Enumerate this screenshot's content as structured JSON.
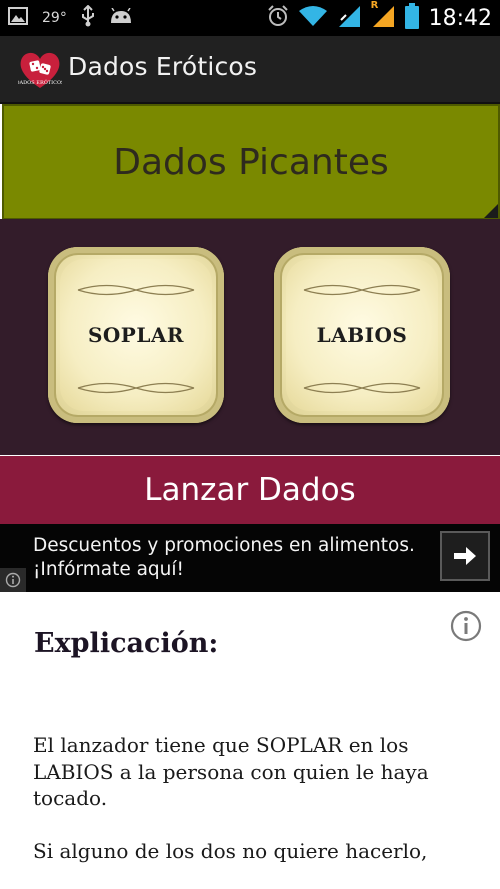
{
  "status_bar": {
    "temperature": "29°",
    "time": "18:42",
    "roaming_indicator": "R",
    "icons_left": [
      "gallery-icon",
      "usb-icon",
      "android-debug-icon"
    ],
    "icons_right": [
      "alarm-icon",
      "wifi-icon",
      "signal-icon",
      "signal-roaming-icon",
      "battery-icon"
    ]
  },
  "action_bar": {
    "title": "Dados Eróticos",
    "logo_caption": "DADOS ERÓTICOS"
  },
  "category": {
    "label": "Dados Picantes"
  },
  "dice": [
    {
      "word": "SOPLAR"
    },
    {
      "word": "LABIOS"
    }
  ],
  "roll_button": {
    "label": "Lanzar Dados"
  },
  "ad": {
    "line1": "Descuentos y promociones en alimentos.",
    "line2": "¡Infórmate aquí!"
  },
  "explanation": {
    "title": "Explicación:",
    "paragraphs": [
      "El lanzador tiene que SOPLAR en los LABIOS a la persona con quien le haya tocado.",
      "Si alguno de los dos no quiere hacerlo,"
    ]
  },
  "colors": {
    "status_bar": "#000000",
    "action_bar": "#212121",
    "category_bg": "#7a8900",
    "dice_area_bg": "#331c2a",
    "roll_button_bg": "#8a1a3c",
    "ad_bg": "#050505",
    "accent_blue": "#33b5e5",
    "roaming_orange": "#f5a623"
  }
}
